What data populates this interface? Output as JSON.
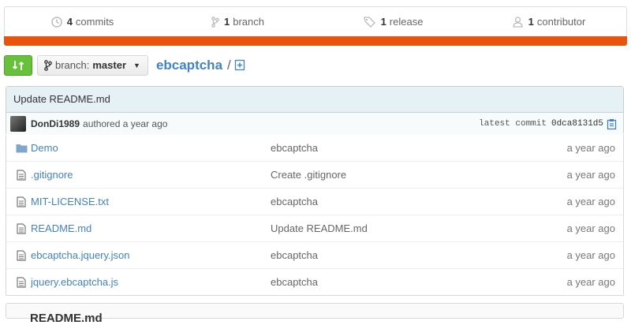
{
  "stats": {
    "commits": {
      "count": "4",
      "label": "commits",
      "icon": "history-icon"
    },
    "branches": {
      "count": "1",
      "label": "branch",
      "icon": "branch-icon"
    },
    "releases": {
      "count": "1",
      "label": "release",
      "icon": "tag-icon"
    },
    "contributors": {
      "count": "1",
      "label": "contributor",
      "icon": "organization-icon"
    }
  },
  "language_color": "#e8530e",
  "nav": {
    "branch_prefix": "branch:",
    "branch_name": "master",
    "repo_name": "ebcaptcha",
    "path_separator": "/"
  },
  "commit": {
    "message": "Update README.md",
    "author": "DonDi1989",
    "authored": "authored a year ago",
    "latest_label": "latest commit",
    "sha": "0dca8131d5"
  },
  "files": [
    {
      "name": "Demo",
      "type": "folder",
      "message": "ebcaptcha",
      "age": "a year ago"
    },
    {
      "name": ".gitignore",
      "type": "file",
      "message": "Create .gitignore",
      "age": "a year ago"
    },
    {
      "name": "MIT-LICENSE.txt",
      "type": "file",
      "message": "ebcaptcha",
      "age": "a year ago"
    },
    {
      "name": "README.md",
      "type": "file",
      "message": "Update README.md",
      "age": "a year ago"
    },
    {
      "name": "ebcaptcha.jquery.json",
      "type": "file",
      "message": "ebcaptcha",
      "age": "a year ago"
    },
    {
      "name": "jquery.ebcaptcha.js",
      "type": "file",
      "message": "ebcaptcha",
      "age": "a year ago"
    }
  ],
  "readme": {
    "title": "README.md"
  }
}
